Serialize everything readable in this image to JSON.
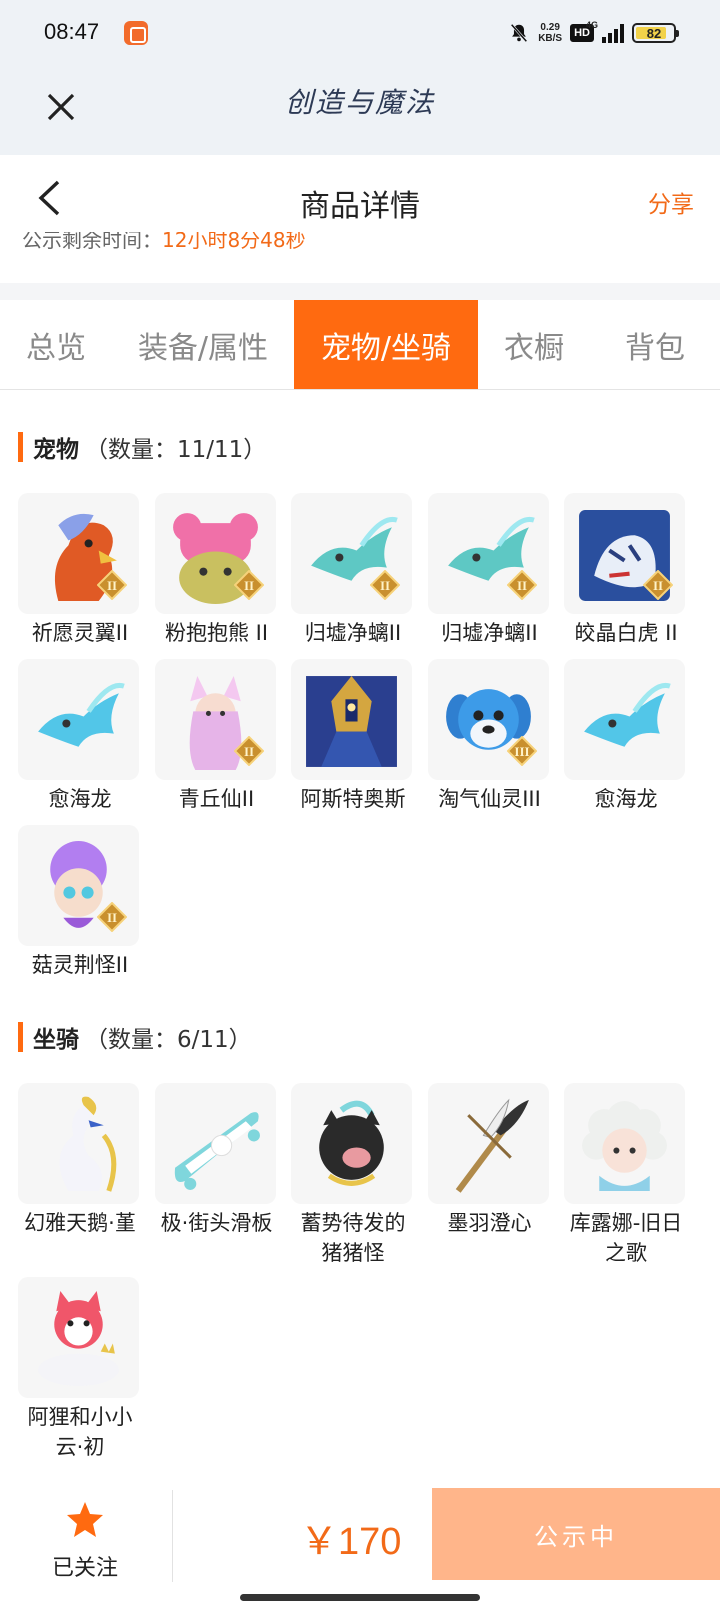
{
  "status_bar": {
    "time": "08:47",
    "net_speed_value": "0.29",
    "net_speed_unit": "KB/S",
    "hd": "HD",
    "network": "4G",
    "battery": "82",
    "battery_level": 0.82
  },
  "game_header": {
    "title": "创造与魔法"
  },
  "nav": {
    "title": "商品详情",
    "share": "分享"
  },
  "partial_row": {
    "label": "公示剩余时间：",
    "value": "12小时8分48秒"
  },
  "tabs": [
    {
      "label": "总览",
      "active": false
    },
    {
      "label": "装备/属性",
      "active": false
    },
    {
      "label": "宠物/坐骑",
      "active": true
    },
    {
      "label": "衣橱",
      "active": false
    },
    {
      "label": "背包",
      "active": false
    }
  ],
  "pets": {
    "title": "宠物",
    "count": "（数量：11/11）",
    "items": [
      {
        "name": "祈愿灵翼II",
        "icon": "griffin-pet-icon",
        "tier": "II",
        "color": "#e86a2e"
      },
      {
        "name": "粉抱抱熊 II",
        "icon": "pink-bear-pet-icon",
        "tier": "II",
        "color": "#f070a8"
      },
      {
        "name": "归墟净螭II",
        "icon": "jade-dragon-pet-icon",
        "tier": "II",
        "color": "#5ec8c4"
      },
      {
        "name": "归墟净螭II",
        "icon": "jade-dragon-pet-icon",
        "tier": "II",
        "color": "#5ec8c4"
      },
      {
        "name": "皎晶白虎 II",
        "icon": "white-tiger-pet-icon",
        "tier": "II",
        "color": "#3a6fc0"
      },
      {
        "name": "愈海龙",
        "icon": "sea-dragon-pet-icon",
        "tier": "",
        "color": "#52c6e8"
      },
      {
        "name": "青丘仙II",
        "icon": "fox-fairy-pet-icon",
        "tier": "II",
        "color": "#e0a0e0"
      },
      {
        "name": "阿斯特奥斯",
        "icon": "asterios-pet-icon",
        "tier": "",
        "color": "#2a3f8f"
      },
      {
        "name": "淘气仙灵III",
        "icon": "blue-puppy-pet-icon",
        "tier": "III",
        "color": "#3d9be8"
      },
      {
        "name": "愈海龙",
        "icon": "sea-dragon-pet-icon",
        "tier": "",
        "color": "#52c6e8"
      },
      {
        "name": "菇灵荆怪II",
        "icon": "purple-sprite-pet-icon",
        "tier": "II",
        "color": "#a070e0"
      }
    ]
  },
  "mounts": {
    "title": "坐骑",
    "count": "（数量：6/11）",
    "items": [
      {
        "name": "幻雅天鹅·堇",
        "icon": "swan-mount-icon",
        "color": "#e8c44a"
      },
      {
        "name": "极·街头滑板",
        "icon": "skateboard-mount-icon",
        "color": "#7fd6dc"
      },
      {
        "name": "蓄势待发的猪猪怪",
        "icon": "pig-mount-icon",
        "color": "#2a2a2a"
      },
      {
        "name": "墨羽澄心",
        "icon": "feather-staff-mount-icon",
        "color": "#b08a4a"
      },
      {
        "name": "库露娜-旧日之歌",
        "icon": "cloud-girl-mount-icon",
        "color": "#8fd0e8"
      },
      {
        "name": "阿狸和小小云·初",
        "icon": "fox-cloud-mount-icon",
        "color": "#f0566a"
      }
    ]
  },
  "bottom_bar": {
    "follow_label": "已关注",
    "price": "￥170",
    "status_button": "公示中"
  },
  "colors": {
    "accent": "#ff6a10",
    "price": "#f26a18",
    "status_button": "#ffb58a"
  }
}
